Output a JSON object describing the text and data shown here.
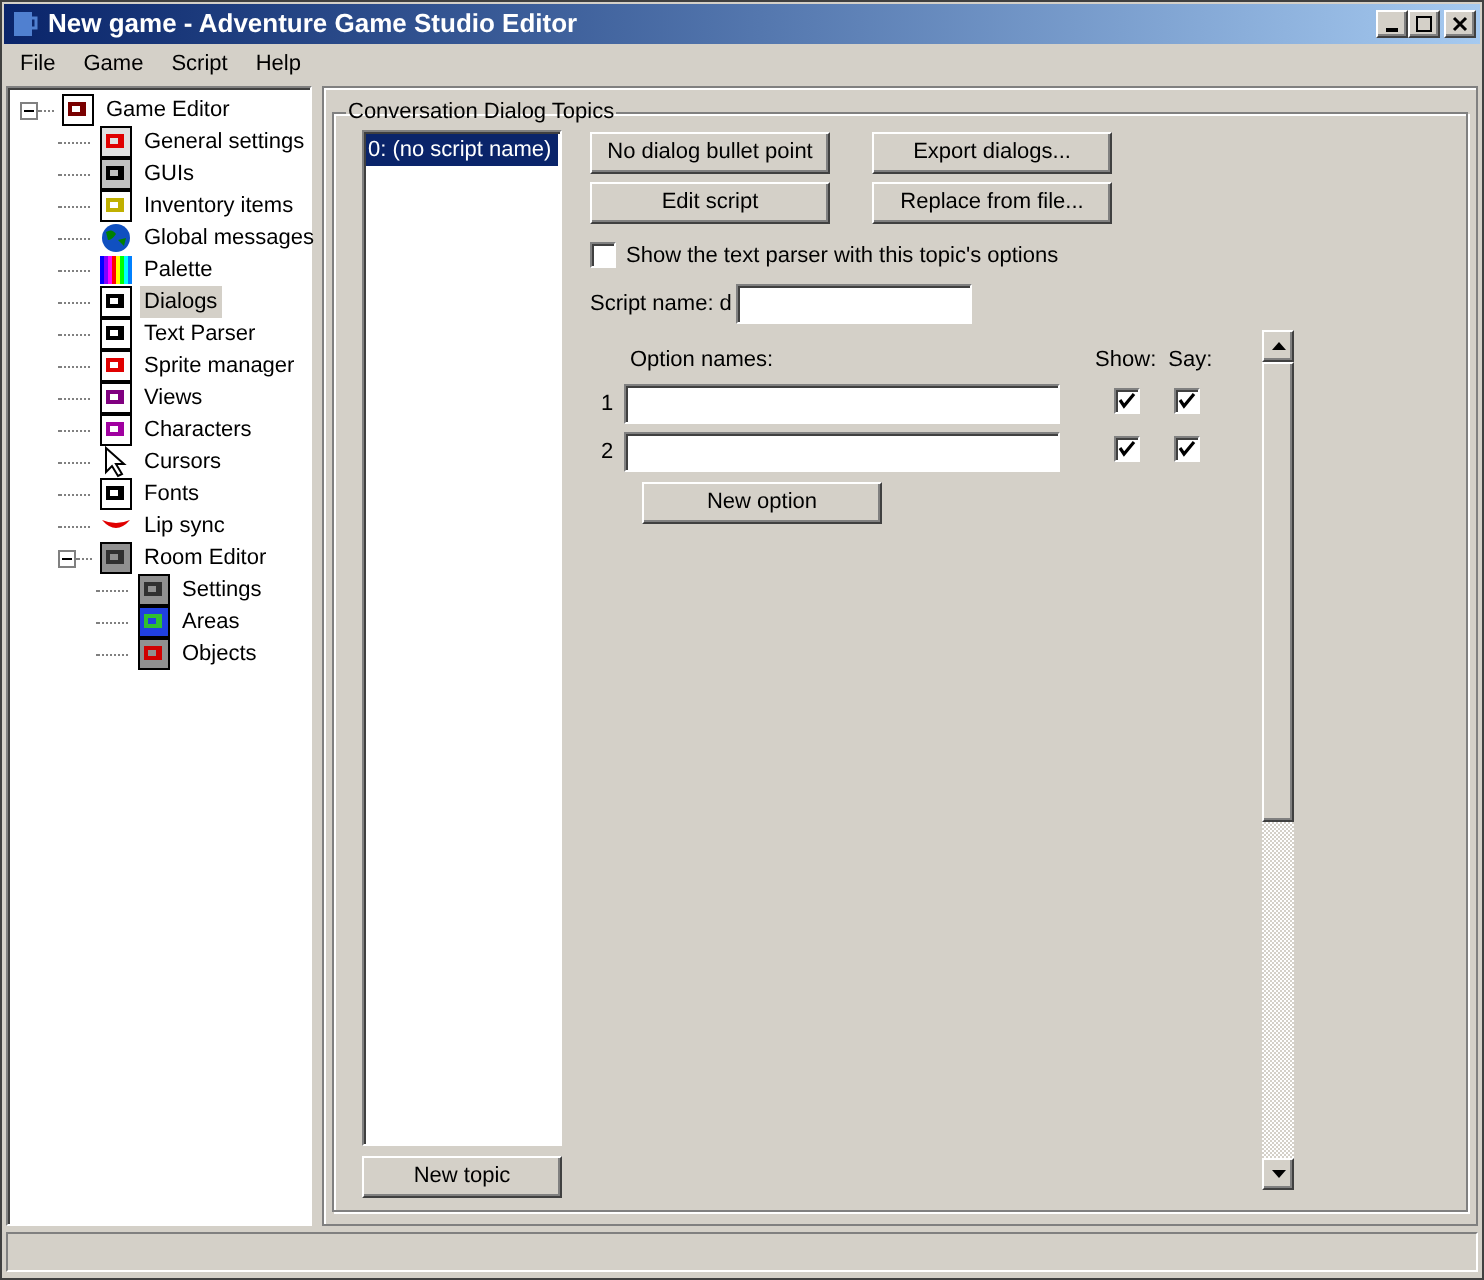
{
  "window": {
    "title": "New game - Adventure Game Studio Editor"
  },
  "menu": [
    "File",
    "Game",
    "Script",
    "Help"
  ],
  "tree": [
    {
      "label": "Game Editor",
      "expanded": true,
      "selected": false,
      "children": [
        {
          "label": "General settings",
          "selected": false
        },
        {
          "label": "GUIs",
          "selected": false
        },
        {
          "label": "Inventory items",
          "selected": false
        },
        {
          "label": "Global messages",
          "selected": false
        },
        {
          "label": "Palette",
          "selected": false
        },
        {
          "label": "Dialogs",
          "selected": true
        },
        {
          "label": "Text Parser",
          "selected": false
        },
        {
          "label": "Sprite manager",
          "selected": false
        },
        {
          "label": "Views",
          "selected": false
        },
        {
          "label": "Characters",
          "selected": false
        },
        {
          "label": "Cursors",
          "selected": false
        },
        {
          "label": "Fonts",
          "selected": false
        },
        {
          "label": "Lip sync",
          "selected": false
        },
        {
          "label": "Room Editor",
          "expanded": true,
          "selected": false,
          "children": [
            {
              "label": "Settings",
              "selected": false
            },
            {
              "label": "Areas",
              "selected": false
            },
            {
              "label": "Objects",
              "selected": false
            }
          ]
        }
      ]
    }
  ],
  "group": {
    "title": "Conversation Dialog Topics",
    "topics": [
      {
        "label": "0: (no script name)",
        "selected": true
      }
    ],
    "new_topic": "New topic",
    "buttons": [
      "No dialog bullet point",
      "Export dialogs...",
      "Edit script",
      "Replace from file..."
    ],
    "text_parser": {
      "label": "Show the text parser with this topic's options",
      "checked": false
    },
    "script_name": {
      "label": "Script name: d"
    },
    "options_header": {
      "names": "Option names:",
      "show": "Show:",
      "say": "Say:"
    },
    "options": [
      {
        "number": "1",
        "show": true,
        "say": true
      },
      {
        "number": "2",
        "show": true,
        "say": true
      }
    ],
    "new_option": "New option"
  }
}
